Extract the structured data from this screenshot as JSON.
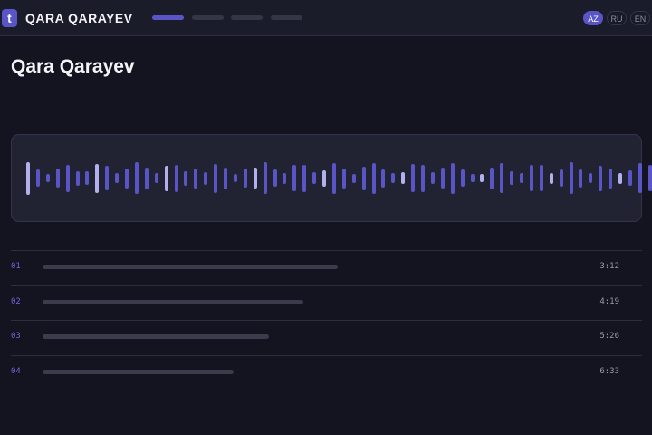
{
  "app": {
    "logo_letter": "t",
    "brand": "QARA QARAYEV"
  },
  "nav": {
    "tabs": [
      {
        "active": true
      },
      {
        "active": false
      },
      {
        "active": false
      },
      {
        "active": false
      }
    ]
  },
  "languages": [
    {
      "code": "AZ",
      "active": true
    },
    {
      "code": "RU",
      "active": false
    },
    {
      "code": "EN",
      "active": false
    }
  ],
  "page": {
    "title": "Qara Qarayev"
  },
  "waveform": {
    "colors": {
      "bar": "#5a55c6",
      "highlight": "#b3b0ee"
    },
    "bars": [
      {
        "h": 0.86,
        "hl": true
      },
      {
        "h": 0.45,
        "hl": false
      },
      {
        "h": 0.22,
        "hl": false
      },
      {
        "h": 0.5,
        "hl": false
      },
      {
        "h": 0.72,
        "hl": false
      },
      {
        "h": 0.37,
        "hl": false
      },
      {
        "h": 0.35,
        "hl": false
      },
      {
        "h": 0.76,
        "hl": true
      },
      {
        "h": 0.64,
        "hl": false
      },
      {
        "h": 0.26,
        "hl": false
      },
      {
        "h": 0.53,
        "hl": false
      },
      {
        "h": 0.84,
        "hl": false
      },
      {
        "h": 0.56,
        "hl": false
      },
      {
        "h": 0.27,
        "hl": false
      },
      {
        "h": 0.67,
        "hl": true
      },
      {
        "h": 0.72,
        "hl": false
      },
      {
        "h": 0.37,
        "hl": false
      },
      {
        "h": 0.52,
        "hl": false
      },
      {
        "h": 0.33,
        "hl": false
      },
      {
        "h": 0.76,
        "hl": false
      },
      {
        "h": 0.56,
        "hl": false
      },
      {
        "h": 0.22,
        "hl": false
      },
      {
        "h": 0.49,
        "hl": false
      },
      {
        "h": 0.54,
        "hl": true
      },
      {
        "h": 0.84,
        "hl": false
      },
      {
        "h": 0.46,
        "hl": false
      },
      {
        "h": 0.28,
        "hl": false
      },
      {
        "h": 0.68,
        "hl": false
      },
      {
        "h": 0.72,
        "hl": false
      },
      {
        "h": 0.32,
        "hl": false
      },
      {
        "h": 0.42,
        "hl": true
      },
      {
        "h": 0.82,
        "hl": false
      },
      {
        "h": 0.52,
        "hl": false
      },
      {
        "h": 0.24,
        "hl": false
      },
      {
        "h": 0.62,
        "hl": false
      },
      {
        "h": 0.82,
        "hl": false
      },
      {
        "h": 0.48,
        "hl": false
      },
      {
        "h": 0.25,
        "hl": false
      },
      {
        "h": 0.3,
        "hl": true
      },
      {
        "h": 0.74,
        "hl": false
      },
      {
        "h": 0.72,
        "hl": false
      },
      {
        "h": 0.3,
        "hl": false
      },
      {
        "h": 0.54,
        "hl": false
      },
      {
        "h": 0.82,
        "hl": false
      },
      {
        "h": 0.45,
        "hl": false
      },
      {
        "h": 0.22,
        "hl": false
      },
      {
        "h": 0.22,
        "hl": true
      },
      {
        "h": 0.58,
        "hl": false
      },
      {
        "h": 0.78,
        "hl": false
      },
      {
        "h": 0.36,
        "hl": false
      },
      {
        "h": 0.26,
        "hl": false
      },
      {
        "h": 0.68,
        "hl": false
      },
      {
        "h": 0.68,
        "hl": false
      },
      {
        "h": 0.28,
        "hl": true
      },
      {
        "h": 0.46,
        "hl": false
      },
      {
        "h": 0.84,
        "hl": false
      },
      {
        "h": 0.48,
        "hl": false
      },
      {
        "h": 0.25,
        "hl": false
      },
      {
        "h": 0.66,
        "hl": false
      },
      {
        "h": 0.52,
        "hl": false
      },
      {
        "h": 0.28,
        "hl": true
      },
      {
        "h": 0.4,
        "hl": false
      },
      {
        "h": 0.78,
        "hl": false
      },
      {
        "h": 0.7,
        "hl": false
      }
    ]
  },
  "tracks": [
    {
      "number": "01",
      "title_fraction": 0.51,
      "duration": "3:12"
    },
    {
      "number": "02",
      "title_fraction": 0.45,
      "duration": "4:19"
    },
    {
      "number": "03",
      "title_fraction": 0.39,
      "duration": "5:26"
    },
    {
      "number": "04",
      "title_fraction": 0.33,
      "duration": "6:33"
    }
  ]
}
